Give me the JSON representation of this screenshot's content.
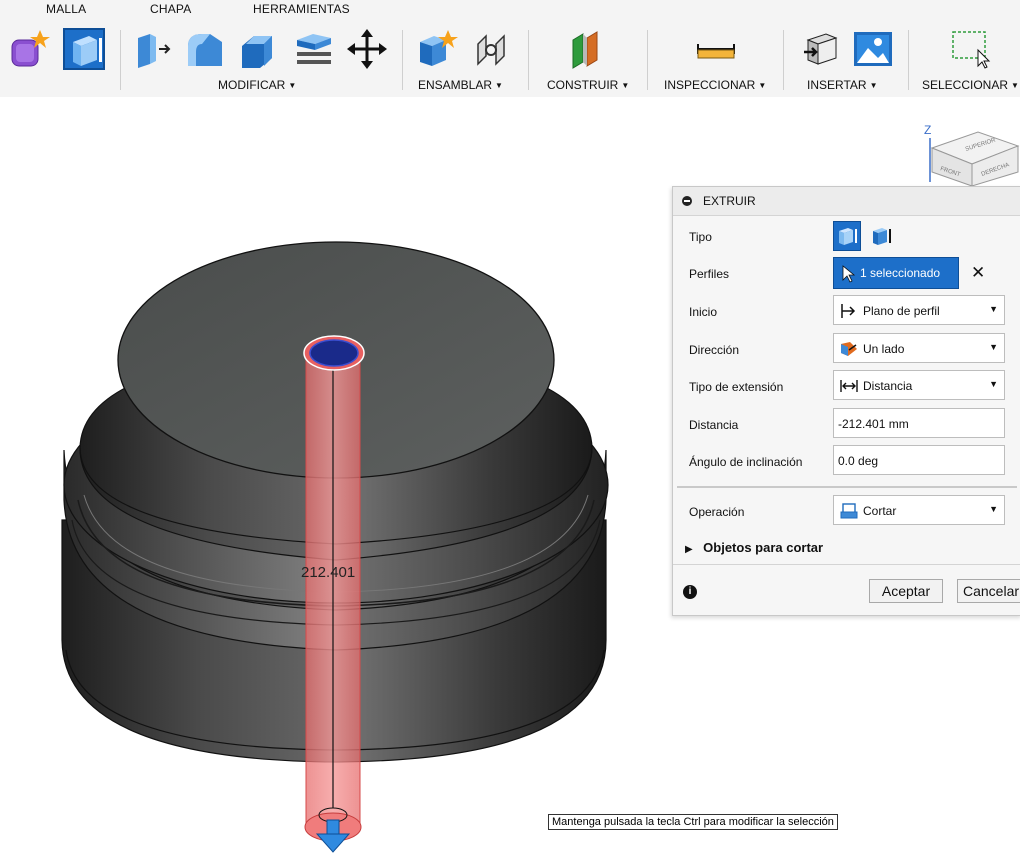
{
  "toolbar": {
    "tabs": [
      "MALLA",
      "CHAPA",
      "HERRAMIENTAS"
    ],
    "groups": {
      "modify": "MODIFICAR",
      "assemble": "ENSAMBLAR",
      "construct": "CONSTRUIR",
      "inspect": "INSPECCIONAR",
      "insert": "INSERTAR",
      "select": "SELECCIONAR"
    },
    "icons": [
      "create-form-icon",
      "extrude-icon",
      "press-pull-icon",
      "fillet-icon",
      "chamfer-icon",
      "shell-icon",
      "move-icon",
      "new-component-icon",
      "joint-icon",
      "offset-plane-icon",
      "measure-icon",
      "insert-derive-icon",
      "insert-canvas-icon",
      "window-select-icon"
    ]
  },
  "viewcube": {
    "axis_label": "Z",
    "face_top": "SUPERIOR",
    "face_front": "FRONT",
    "face_right": "DERECHA"
  },
  "viewport": {
    "dimension_label": "212.401",
    "hint": "Mantenga pulsada la tecla Ctrl para modificar la selección"
  },
  "panel": {
    "title": "EXTRUIR",
    "rows": {
      "tipo": "Tipo",
      "perfiles": "Perfiles",
      "perfiles_value": "1 seleccionado",
      "inicio": "Inicio",
      "inicio_value": "Plano de perfil",
      "direccion": "Dirección",
      "direccion_value": "Un lado",
      "tipo_extension": "Tipo de extensión",
      "tipo_extension_value": "Distancia",
      "distancia": "Distancia",
      "distancia_value": "-212.401 mm",
      "angulo": "Ángulo de inclinación",
      "angulo_value": "0.0 deg",
      "operacion": "Operación",
      "operacion_value": "Cortar",
      "objetos": "Objetos para cortar"
    },
    "ok": "Aceptar",
    "cancel": "Cancelar"
  },
  "colors": {
    "accent": "#1d6fc9",
    "cut_red": "#f06a6a",
    "body": "#3a3a3a"
  }
}
